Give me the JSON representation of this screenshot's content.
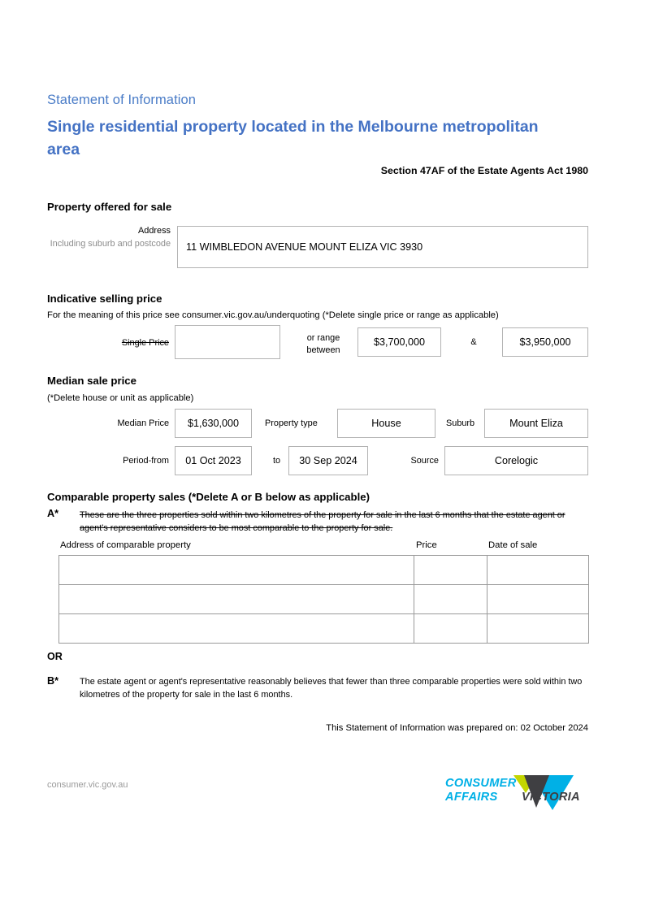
{
  "header": {
    "eyebrow": "Statement of Information",
    "title": "Single residential property located in the Melbourne metropolitan area",
    "act_reference": "Section 47AF of the Estate Agents Act 1980",
    "color_eyebrow": "#4a7cc7",
    "color_title": "#4472c4"
  },
  "property_offered": {
    "heading": "Property offered for sale",
    "address_label": "Address",
    "address_sublabel": "Including suburb and postcode",
    "address_value": "11 WIMBLEDON AVENUE MOUNT ELIZA VIC 3930"
  },
  "indicative_price": {
    "heading": "Indicative selling price",
    "note": "For the meaning of this price see consumer.vic.gov.au/underquoting (*Delete single price or range as applicable)",
    "single_price_label": "Single Price",
    "single_price_value": "",
    "or_range_label": "or range between",
    "range_low": "$3,700,000",
    "ampersand": "&",
    "range_high": "$3,950,000"
  },
  "median_price": {
    "heading": "Median sale price",
    "note": "(*Delete house or unit as applicable)",
    "median_price_label": "Median Price",
    "median_price_value": "$1,630,000",
    "property_type_label": "Property type",
    "property_type_value": "House",
    "suburb_label": "Suburb",
    "suburb_value": "Mount Eliza",
    "period_from_label": "Period-from",
    "period_from_value": "01 Oct 2023",
    "to_label": "to",
    "period_to_value": "30 Sep 2024",
    "source_label": "Source",
    "source_value": "Corelogic"
  },
  "comparable_sales": {
    "heading": "Comparable property sales (*Delete A or B below as applicable)",
    "option_a_marker": "A*",
    "option_a_text": "These are the three properties sold within two kilometres of the property for sale in the last 6 months that the estate agent or agent's representative considers to be most comparable to the property for sale.",
    "columns": [
      "Address of comparable property",
      "Price",
      "Date of sale"
    ],
    "rows": [
      {
        "address": "",
        "price": "",
        "date_of_sale": ""
      },
      {
        "address": "",
        "price": "",
        "date_of_sale": ""
      },
      {
        "address": "",
        "price": "",
        "date_of_sale": ""
      }
    ],
    "or_label": "OR",
    "option_b_marker": "B*",
    "option_b_text": "The estate agent or agent's representative reasonably believes that fewer than three comparable properties were sold within two kilometres of the property for sale in the last 6 months."
  },
  "prepared_on": "This Statement of Information was prepared on: 02 October 2024",
  "footer": {
    "url": "consumer.vic.gov.au",
    "logo_line1": "CONSUMER",
    "logo_line2": "AFFAIRS",
    "logo_victoria": "VICTORIA",
    "logo_color_primary": "#00b0e6",
    "logo_color_victoria": "#3f3f42",
    "logo_color_accent": "#c3d600"
  }
}
